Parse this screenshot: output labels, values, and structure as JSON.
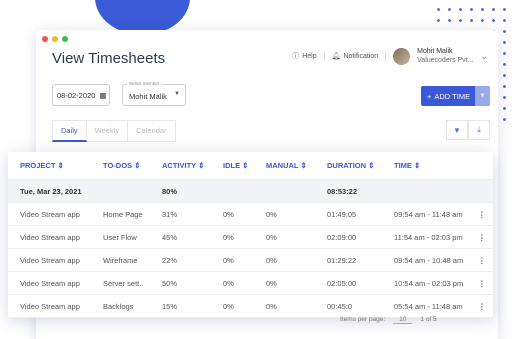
{
  "window": {
    "traffic": [
      "red",
      "yellow",
      "green"
    ]
  },
  "colors": {
    "accent": "#3a57d7",
    "blob": "#3b5ad6"
  },
  "header": {
    "title": "View Timesheets",
    "help": "Help",
    "notification": "Notification",
    "user_name": "Mohit Malik",
    "user_org": "Valuecoders Pvt..."
  },
  "filters": {
    "date": "08-02-2020",
    "member_label": "Select member",
    "member_value": "Mohit Malik",
    "add_time": "ADD TIME"
  },
  "tabs": [
    "Daily",
    "Weekly",
    "Calendar"
  ],
  "table": {
    "headers": [
      "PROJECT",
      "TO-DOS",
      "ACTIVITY",
      "IDLE",
      "MANUAL",
      "DURATION",
      "TIME"
    ],
    "group": {
      "date": "Tue, Mar 23, 2021",
      "activity": "80%",
      "duration": "08:53:22"
    },
    "rows": [
      {
        "project": "Video Stream app",
        "todo": "Home Page",
        "activity": "31%",
        "idle": "0%",
        "manual": "0%",
        "duration": "01:49:05",
        "time": "09:54 am - 11:48 am"
      },
      {
        "project": "Video Stream app",
        "todo": "User Flow",
        "activity": "45%",
        "idle": "0%",
        "manual": "0%",
        "duration": "02:09:00",
        "time": "11:54 am - 02:03 pm"
      },
      {
        "project": "Video Stream app",
        "todo": "Wireframe",
        "activity": "22%",
        "idle": "0%",
        "manual": "0%",
        "duration": "01:29:22",
        "time": "09:54 am - 10:48 am"
      },
      {
        "project": "Video Stream app",
        "todo": "Server sett..",
        "activity": "50%",
        "idle": "0%",
        "manual": "0%",
        "duration": "02:05:00",
        "time": "10:54 am - 02:03 pm"
      },
      {
        "project": "Video Stream app",
        "todo": "Backlogs",
        "activity": "15%",
        "idle": "0%",
        "manual": "0%",
        "duration": "00:45:0",
        "time": "05:54 am - 11:48 am"
      }
    ]
  },
  "pager": {
    "items_per_page": "Items per page:",
    "per_page_value": "10",
    "range": "1 of 5"
  }
}
